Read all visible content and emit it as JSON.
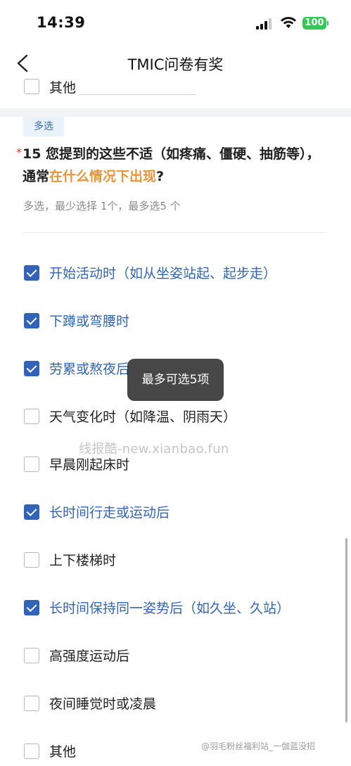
{
  "status_bar": {
    "time": "14:39",
    "battery": "100"
  },
  "nav": {
    "title": "TMIC问卷有奖"
  },
  "prev_option": {
    "label": "其他"
  },
  "question": {
    "tag": "多选",
    "required_mark": "*",
    "text_part1": "15 您提到的这些不适（如疼痛、僵硬、抽筋等），通常",
    "text_highlight": "在什么情况下出现",
    "text_part2": "?",
    "hint": "多选，最少选择 1个，最多选5 个"
  },
  "options": [
    {
      "label": "开始活动时（如从坐姿站起、起步走）",
      "checked": true
    },
    {
      "label": "下蹲或弯腰时",
      "checked": true
    },
    {
      "label": "劳累或熬夜后",
      "checked": true
    },
    {
      "label": "天气变化时（如降温、阴雨天）",
      "checked": false
    },
    {
      "label": "早晨刚起床时",
      "checked": false
    },
    {
      "label": "长时间行走或运动后",
      "checked": true
    },
    {
      "label": "上下楼梯时",
      "checked": false
    },
    {
      "label": "长时间保持同一姿势后（如久坐、久站）",
      "checked": true
    },
    {
      "label": "高强度运动后",
      "checked": false
    },
    {
      "label": "夜间睡觉时或凌晨",
      "checked": false
    },
    {
      "label": "其他",
      "checked": false
    }
  ],
  "toast": {
    "text": "最多可选5项"
  },
  "watermark": {
    "text": "线报酷-new.xianbao.fun"
  },
  "corner_watermark": {
    "text": "@羽毛粉丝福利站_一伽蓝没招"
  },
  "colors": {
    "accent": "#3164b9",
    "highlight": "#e8953a",
    "required": "#e23a2e"
  }
}
